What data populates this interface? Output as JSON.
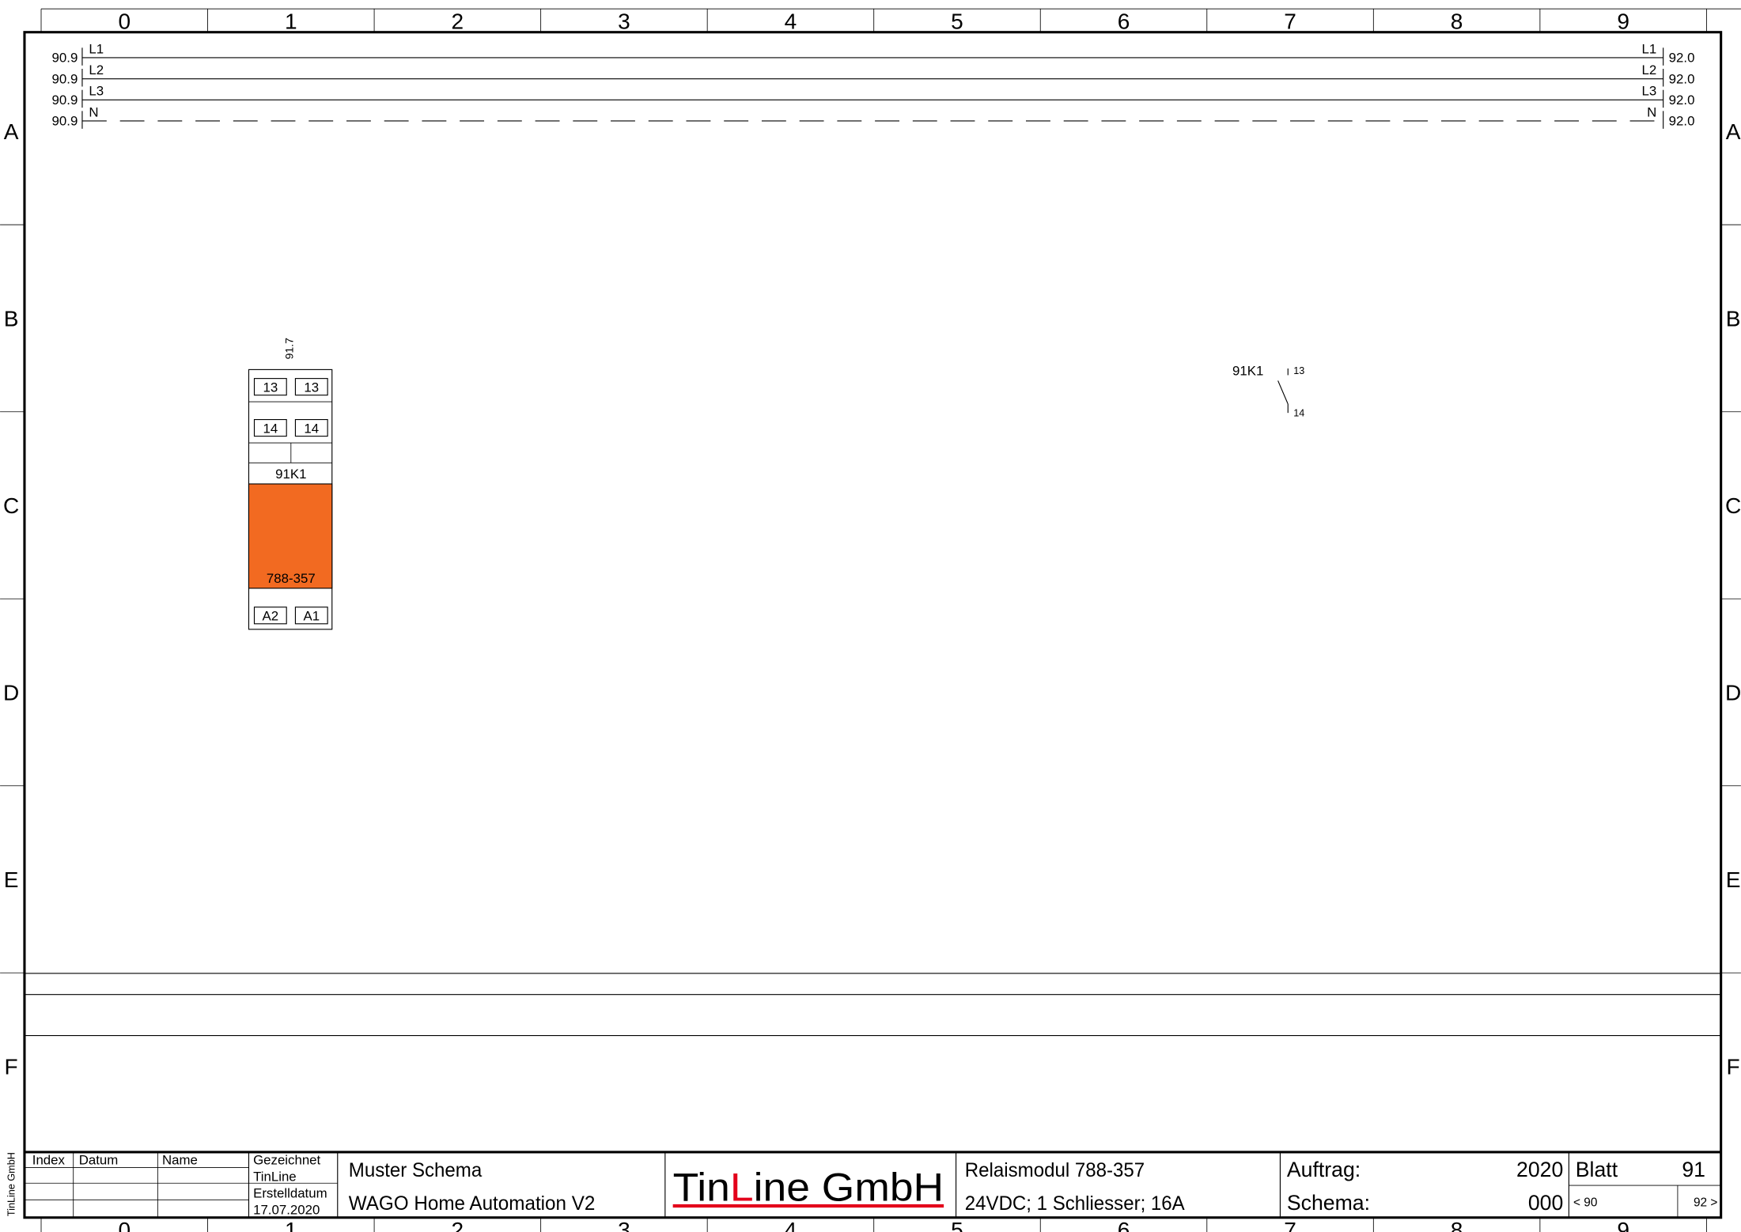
{
  "columns": [
    "0",
    "1",
    "2",
    "3",
    "4",
    "5",
    "6",
    "7",
    "8",
    "9"
  ],
  "rows": [
    "A",
    "B",
    "C",
    "D",
    "E",
    "F"
  ],
  "potentials": [
    {
      "name": "L1",
      "ref_left": "90.9",
      "ref_right": "92.0"
    },
    {
      "name": "L2",
      "ref_left": "90.9",
      "ref_right": "92.0"
    },
    {
      "name": "L3",
      "ref_left": "90.9",
      "ref_right": "92.0"
    },
    {
      "name": "N",
      "ref_left": "90.9",
      "ref_right": "92.0"
    }
  ],
  "relay_module": {
    "crossref": "91.7",
    "terminals_top": [
      "13",
      "13"
    ],
    "terminals_mid": [
      "14",
      "14"
    ],
    "tag": "91K1",
    "part_no": "788-357",
    "terminals_bottom": [
      "A2",
      "A1"
    ],
    "body_color": "#F26A21"
  },
  "contact": {
    "tag": "91K1",
    "pin_top": "13",
    "pin_bottom": "14"
  },
  "title_block": {
    "side_text": "TinLine GmbH",
    "rev_headers": {
      "index": "Index",
      "datum": "Datum",
      "name": "Name"
    },
    "drawn_label": "Gezeichnet",
    "drawn_by": "TinLine",
    "date_label": "Erstelldatum",
    "date": "17.07.2020",
    "project_line1": "Muster Schema",
    "project_line2": "WAGO Home Automation V2",
    "company_logo": "TinLine GmbH",
    "logo_part1": "Tin",
    "logo_part2": "L",
    "logo_part3": "ine GmbH",
    "logo_accent": "#E3001B",
    "desc_line1": "Relaismodul 788-357",
    "desc_line2": "24VDC; 1 Schliesser; 16A",
    "auftrag_label": "Auftrag:",
    "auftrag_value": "2020",
    "schema_label": "Schema:",
    "schema_value": "000",
    "blatt_label": "Blatt",
    "blatt_value": "91",
    "prev_sheet": "< 90",
    "next_sheet": "92 >"
  }
}
